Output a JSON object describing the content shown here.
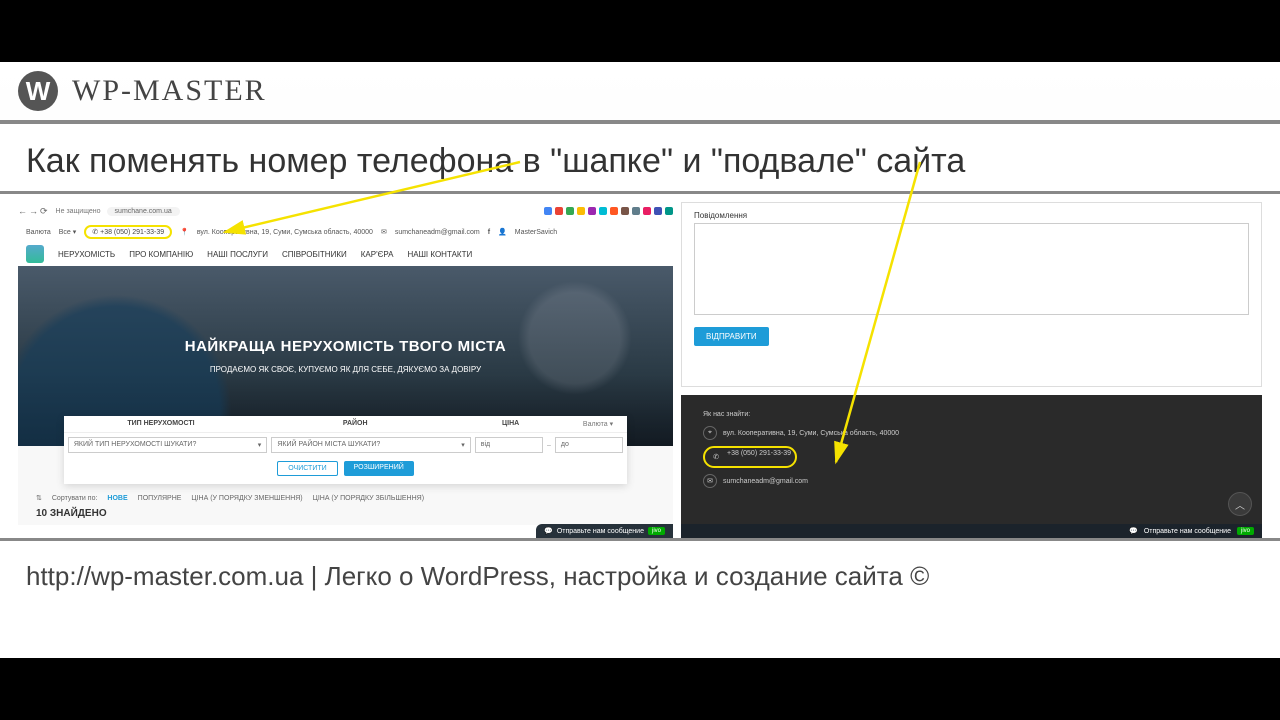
{
  "brand": "WP-MASTER",
  "title": "Как поменять номер телефона в \"шапке\" и \"подвале\" сайта",
  "footer_text": "http://wp-master.com.ua | Легко о WordPress, настройка и создание сайта ©",
  "left": {
    "url_security": "Не защищено",
    "url": "sumchane.com.ua",
    "header": {
      "currency_lbl": "Валюта",
      "currency_val": "Все ▾",
      "phone": "+38 (050) 291-33-39",
      "address": "вул. Кооперативна, 19, Суми, Сумська область, 40000",
      "email": "sumchaneadm@gmail.com",
      "user": "MasterSavich"
    },
    "menu": [
      "НЕРУХОМІСТЬ",
      "ПРО КОМПАНІЮ",
      "НАШІ ПОСЛУГИ",
      "СПІВРОБІТНИКИ",
      "КАР'ЄРА",
      "НАШІ КОНТАКТИ"
    ],
    "hero_title": "НАЙКРАЩА НЕРУХОМІСТЬ ТВОГО МІСТА",
    "hero_sub": "ПРОДАЄМО ЯК СВОЄ, КУПУЄМО ЯК ДЛЯ СЕБЕ, ДЯКУЄМО ЗА ДОВІРУ",
    "search": {
      "col1": "ТИП НЕРУХОМОСТІ",
      "col2": "РАЙОН",
      "col3": "ЦІНА",
      "cur": "Валюта ▾",
      "sel1": "ЯКИЙ ТИП НЕРУХОМОСТІ ШУКАТИ?",
      "sel2": "ЯКИЙ РАЙОН МІСТА ШУКАТИ?",
      "from": "від",
      "to": "до",
      "btn_clear": "ОЧИСТИТИ",
      "btn_adv": "РОЗШИРЕНИЙ"
    },
    "sort": {
      "label": "Сортувати по:",
      "new": "НОВЕ",
      "pop": "ПОПУЛЯРНЕ",
      "desc": "ЦІНА (У ПОРЯДКУ ЗМЕНШЕННЯ)",
      "asc": "ЦІНА (У ПОРЯДКУ ЗБІЛЬШЕННЯ)"
    },
    "found": "10 ЗНАЙДЕНО",
    "chat": "Отправьте нам сообщение",
    "jivo": "jivo"
  },
  "right": {
    "form_label": "Повідомлення",
    "btn_send": "ВІДПРАВИТИ",
    "footer": {
      "find_us": "Як нас знайти:",
      "address": "вул. Кооперативна, 19, Суми, Сумська область, 40000",
      "phone": "+38 (050) 291-33-39",
      "email": "sumchaneadm@gmail.com"
    },
    "chat": "Отправьте нам сообщение",
    "jivo": "jivo"
  }
}
